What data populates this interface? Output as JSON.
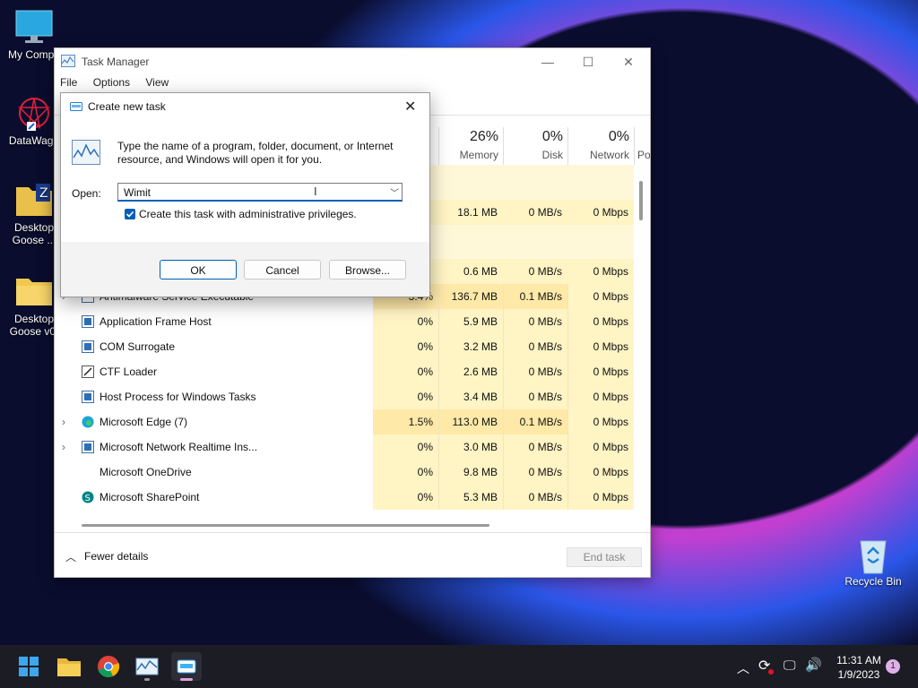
{
  "desktop": {
    "icons": [
      {
        "label": "My Compu"
      },
      {
        "label": "DataWago"
      },
      {
        "label": "Desktop Goose ..."
      },
      {
        "label": "Desktop Goose v0."
      },
      {
        "label": "Recycle Bin"
      }
    ]
  },
  "task_manager": {
    "title": "Task Manager",
    "menu": [
      "File",
      "Options",
      "View"
    ],
    "columns": [
      {
        "pct": "26%",
        "label": "Memory"
      },
      {
        "pct": "0%",
        "label": "Disk"
      },
      {
        "pct": "0%",
        "label": "Network"
      },
      {
        "pct": "",
        "label": "Po"
      }
    ],
    "partial_rows": [
      {
        "cpu": "",
        "mem": "18.1 MB",
        "disk": "0 MB/s",
        "net": "0 Mbps"
      },
      {
        "cpu": "",
        "mem": "0.6 MB",
        "disk": "0 MB/s",
        "net": "0 Mbps"
      }
    ],
    "rows": [
      {
        "name": "Antimalware Service Executable",
        "cpu": "3.4%",
        "mem": "136.7 MB",
        "disk": "0.1 MB/s",
        "net": "0 Mbps",
        "expand": "›"
      },
      {
        "name": "Application Frame Host",
        "cpu": "0%",
        "mem": "5.9 MB",
        "disk": "0 MB/s",
        "net": "0 Mbps",
        "expand": ""
      },
      {
        "name": "COM Surrogate",
        "cpu": "0%",
        "mem": "3.2 MB",
        "disk": "0 MB/s",
        "net": "0 Mbps",
        "expand": ""
      },
      {
        "name": "CTF Loader",
        "cpu": "0%",
        "mem": "2.6 MB",
        "disk": "0 MB/s",
        "net": "0 Mbps",
        "expand": ""
      },
      {
        "name": "Host Process for Windows Tasks",
        "cpu": "0%",
        "mem": "3.4 MB",
        "disk": "0 MB/s",
        "net": "0 Mbps",
        "expand": ""
      },
      {
        "name": "Microsoft Edge (7)",
        "cpu": "1.5%",
        "mem": "113.0 MB",
        "disk": "0.1 MB/s",
        "net": "0 Mbps",
        "expand": "›"
      },
      {
        "name": "Microsoft Network Realtime Ins...",
        "cpu": "0%",
        "mem": "3.0 MB",
        "disk": "0 MB/s",
        "net": "0 Mbps",
        "expand": "›"
      },
      {
        "name": "Microsoft OneDrive",
        "cpu": "0%",
        "mem": "9.8 MB",
        "disk": "0 MB/s",
        "net": "0 Mbps",
        "expand": ""
      },
      {
        "name": "Microsoft SharePoint",
        "cpu": "0%",
        "mem": "5.3 MB",
        "disk": "0 MB/s",
        "net": "0 Mbps",
        "expand": ""
      }
    ],
    "fewer_details": "Fewer details",
    "end_task": "End task"
  },
  "dialog": {
    "title": "Create new task",
    "description": "Type the name of a program, folder, document, or Internet resource, and Windows will open it for you.",
    "open_label": "Open:",
    "open_value": "Wimit",
    "admin_checkbox_label": "Create this task with administrative privileges.",
    "admin_checked": true,
    "ok": "OK",
    "cancel": "Cancel",
    "browse": "Browse..."
  },
  "taskbar": {
    "time": "11:31 AM",
    "date": "1/9/2023",
    "notification_count": "1"
  },
  "colors": {
    "accent": "#005fb8",
    "cell_highlight": "#fff4c4",
    "cell_highlight_strong": "#ffe9a8"
  }
}
